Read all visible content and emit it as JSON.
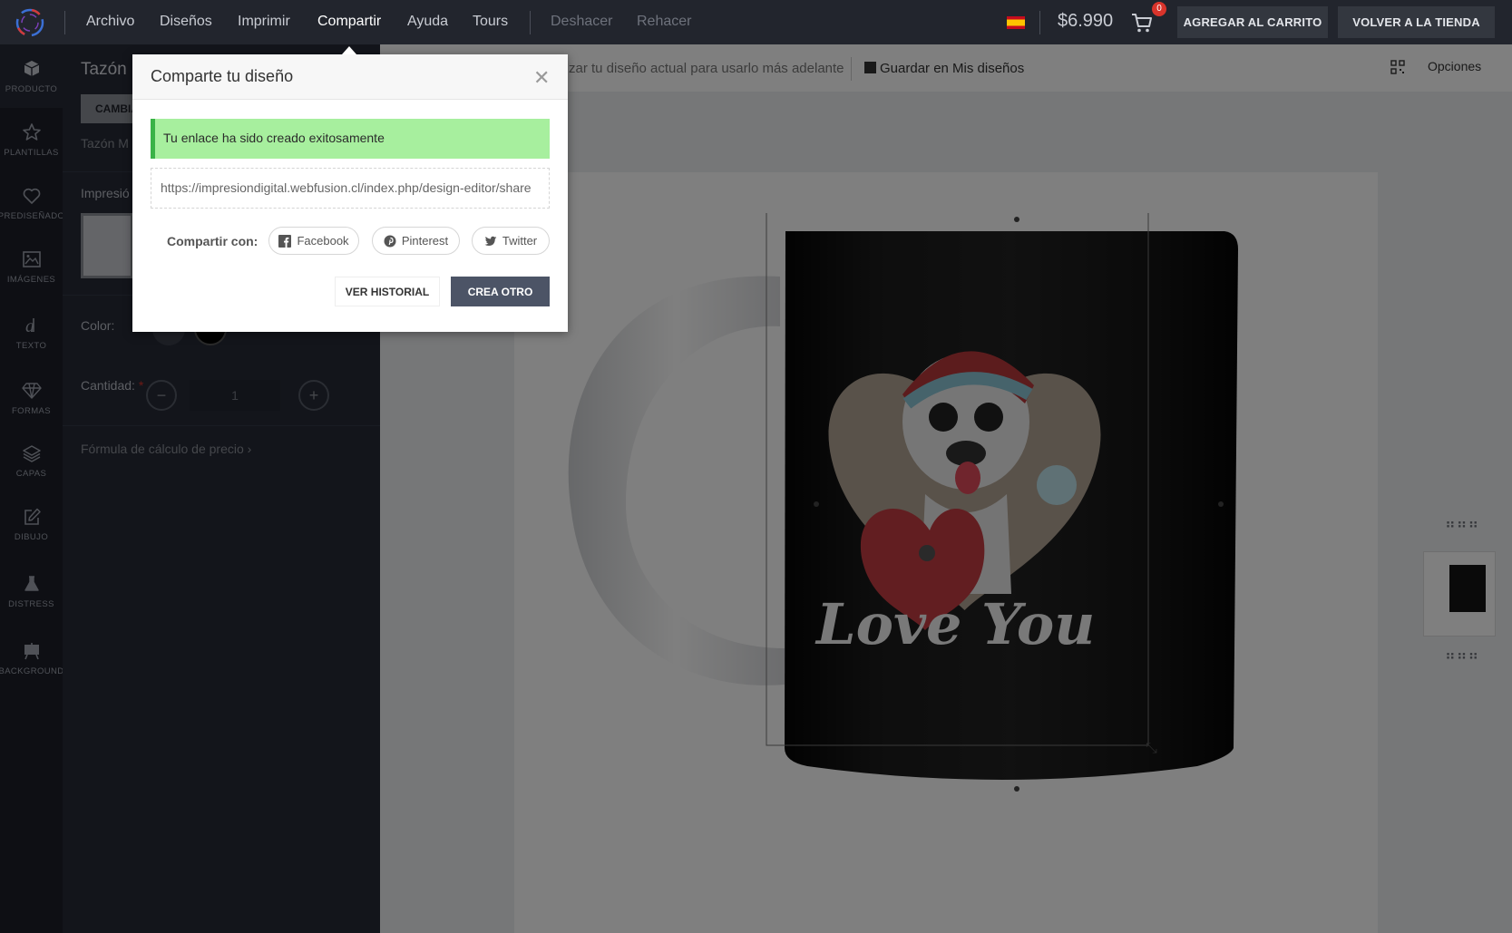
{
  "topbar": {
    "menu": [
      {
        "label": "Archivo",
        "state": "normal"
      },
      {
        "label": "Diseños",
        "state": "normal"
      },
      {
        "label": "Imprimir",
        "state": "normal"
      },
      {
        "label": "Compartir",
        "state": "active"
      },
      {
        "label": "Ayuda",
        "state": "normal"
      },
      {
        "label": "Tours",
        "state": "normal"
      },
      {
        "label": "Deshacer",
        "state": "disabled"
      },
      {
        "label": "Rehacer",
        "state": "disabled"
      }
    ],
    "price": "$6.990",
    "cart_count": "0",
    "add_to_cart": "AGREGAR AL CARRITO",
    "back_to_store": "VOLVER A LA TIENDA"
  },
  "sidebar": {
    "items": [
      {
        "label": "PRODUCTO",
        "icon": "box-icon"
      },
      {
        "label": "PLANTILLAS",
        "icon": "star-icon"
      },
      {
        "label": "PREDISEÑADO",
        "icon": "heart-icon"
      },
      {
        "label": "IMÁGENES",
        "icon": "image-icon"
      },
      {
        "label": "TEXTO",
        "icon": "text-icon"
      },
      {
        "label": "FORMAS",
        "icon": "diamond-icon"
      },
      {
        "label": "CAPAS",
        "icon": "layers-icon"
      },
      {
        "label": "DIBUJO",
        "icon": "edit-icon"
      },
      {
        "label": "DISTRESS",
        "icon": "flask-icon"
      },
      {
        "label": "BACKGROUND",
        "icon": "easel-icon"
      }
    ]
  },
  "panel": {
    "title": "Tazón",
    "change_button": "CAMBIA",
    "subtitle": "Tazón M",
    "print_label": "Impresió",
    "color_label": "Color:",
    "quantity_label": "Cantidad:",
    "required_mark": "*",
    "quantity_value": "1",
    "formula_link": "Fórmula de cálculo de precio"
  },
  "toolbar": {
    "save_hint": "zar tu diseño actual para usarlo más adelante",
    "save_button": "Guardar en Mis diseños",
    "options": "Opciones"
  },
  "design": {
    "text": "Love You"
  },
  "modal": {
    "title": "Comparte tu diseño",
    "success_message": "Tu enlace ha sido creado exitosamente",
    "link_value": "https://impresiondigital.webfusion.cl/index.php/design-editor/share",
    "share_label": "Compartir con:",
    "facebook": "Facebook",
    "pinterest": "Pinterest",
    "twitter": "Twitter",
    "history_button": "VER HISTORIAL",
    "create_button": "CREA OTRO"
  },
  "colors": {
    "topbar": "#22252d",
    "sidebar": "#1c1f29",
    "panel": "#262a36",
    "success": "#a7ef9e",
    "primary_button": "#4c5466"
  }
}
